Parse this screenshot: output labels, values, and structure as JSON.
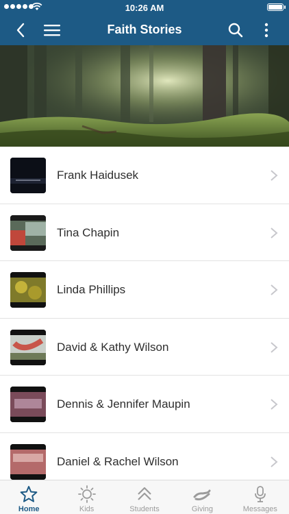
{
  "status_bar": {
    "time": "10:26 AM"
  },
  "header": {
    "title": "Faith Stories"
  },
  "stories": [
    {
      "name": "Frank Haidusek"
    },
    {
      "name": "Tina Chapin"
    },
    {
      "name": "Linda Phillips"
    },
    {
      "name": "David & Kathy Wilson"
    },
    {
      "name": "Dennis & Jennifer Maupin"
    },
    {
      "name": "Daniel & Rachel Wilson"
    }
  ],
  "tabbar": {
    "tabs": [
      {
        "label": "Home",
        "icon": "star-icon",
        "active": true
      },
      {
        "label": "Kids",
        "icon": "sun-icon",
        "active": false
      },
      {
        "label": "Students",
        "icon": "double-chevron-up-icon",
        "active": false
      },
      {
        "label": "Giving",
        "icon": "giving-hand-icon",
        "active": false
      },
      {
        "label": "Messages",
        "icon": "microphone-icon",
        "active": false
      }
    ]
  },
  "colors": {
    "brand": "#1d5a85",
    "tab_inactive": "#9b9b9b",
    "divider": "#e2e2e2"
  }
}
